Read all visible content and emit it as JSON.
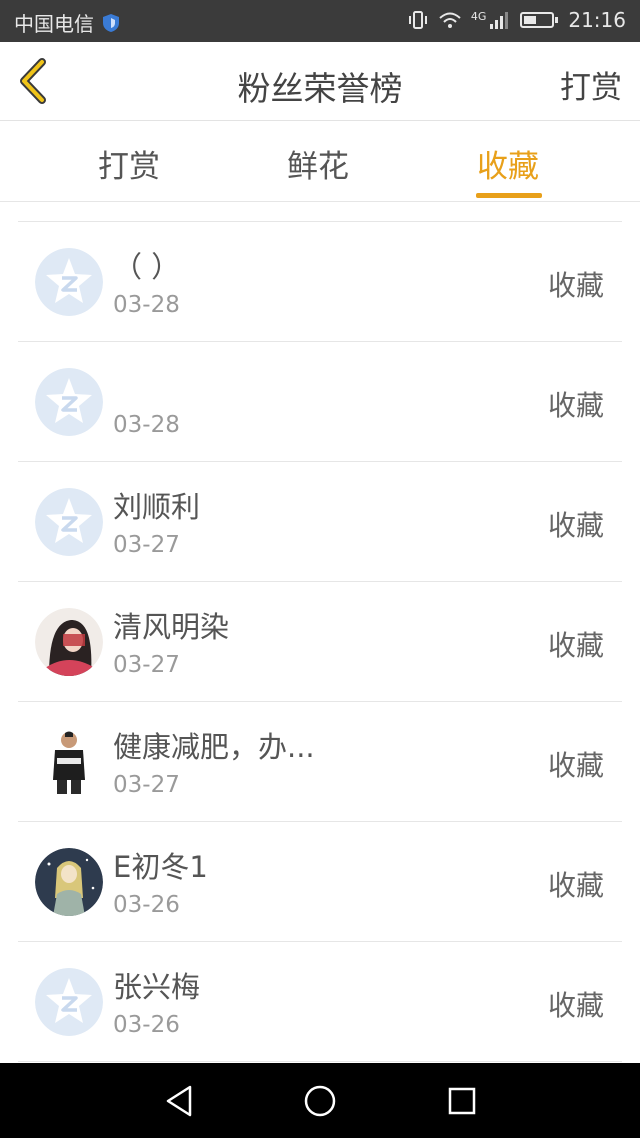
{
  "status_bar": {
    "carrier": "中国电信",
    "network": "4G",
    "time": "21:16",
    "icons": [
      "shield-icon",
      "vibrate-icon",
      "wifi-icon",
      "signal-icon",
      "battery-icon"
    ]
  },
  "header": {
    "back_icon": "chevron-left-icon",
    "title": "粉丝荣誉榜",
    "action_label": "打赏"
  },
  "tabs": [
    {
      "label": "打赏",
      "active": false
    },
    {
      "label": "鲜花",
      "active": false
    },
    {
      "label": "收藏",
      "active": true
    }
  ],
  "accent_color": "#e8a01a",
  "list": [
    {
      "name": "（ ）",
      "date": "03-28",
      "type": "收藏",
      "avatar": "default-avatar-icon"
    },
    {
      "name": "",
      "date": "03-28",
      "type": "收藏",
      "avatar": "default-avatar-icon"
    },
    {
      "name": "刘顺利",
      "date": "03-27",
      "type": "收藏",
      "avatar": "default-avatar-icon"
    },
    {
      "name": "清风明染",
      "date": "03-27",
      "type": "收藏",
      "avatar": "girl-photo-avatar"
    },
    {
      "name": "健康减肥，办...",
      "date": "03-27",
      "type": "收藏",
      "avatar": "man-photo-avatar"
    },
    {
      "name": "E初冬1",
      "date": "03-26",
      "type": "收藏",
      "avatar": "anime-photo-avatar"
    },
    {
      "name": "张兴梅",
      "date": "03-26",
      "type": "收藏",
      "avatar": "default-avatar-icon"
    }
  ],
  "nav_bar": [
    "back-triangle-icon",
    "home-circle-icon",
    "recent-square-icon"
  ]
}
